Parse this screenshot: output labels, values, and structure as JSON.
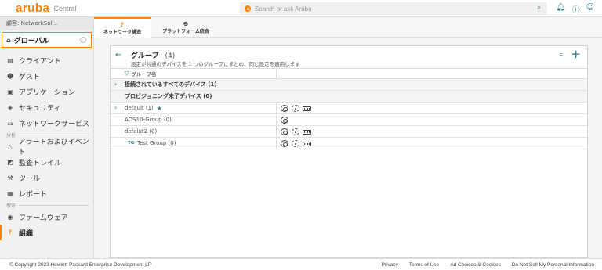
{
  "header": {
    "logo": "aruba",
    "product": "Central",
    "search_placeholder": "Search or ask Aruba"
  },
  "sidebar": {
    "customer": "顧客: NetworkSol...",
    "global_label": "グローバル",
    "items": [
      {
        "label": "クライアント"
      },
      {
        "label": "ゲスト"
      },
      {
        "label": "アプリケーション"
      },
      {
        "label": "セキュリティ"
      },
      {
        "label": "ネットワークサービス"
      }
    ],
    "section_analysis": "分析",
    "analysis_items": [
      {
        "label": "アラートおよびイベント"
      },
      {
        "label": "監査トレイル"
      },
      {
        "label": "ツール"
      },
      {
        "label": "レポート"
      }
    ],
    "section_maintenance": "保守",
    "maintenance_items": [
      {
        "label": "ファームウェア"
      },
      {
        "label": "組織"
      }
    ]
  },
  "tabs": [
    {
      "label": "ネットワーク構造"
    },
    {
      "label": "プラットフォーム統合"
    }
  ],
  "groups_panel": {
    "title": "グループ",
    "count": "(4)",
    "subtitle": "設定が共通のデバイスを 1 つのグループにまとめ、同じ設定を適用します",
    "column_header": "グループ名",
    "all_devices": "接続されているすべてのデバイス (1)",
    "unprovisioned": "プロビジョニング未了デバイス (0)",
    "rows": [
      {
        "name": "default (1)"
      },
      {
        "name": "AOS10-Group (0)"
      },
      {
        "name": "defalut2 (0)"
      },
      {
        "badge": "TG",
        "name": "Test Group (0)"
      }
    ]
  },
  "footer": {
    "copyright": "© Copyright 2023 Hewlett Packard Enterprise Development LP",
    "links": [
      "Privacy",
      "Terms of Use",
      "Ad Choices & Cookies",
      "Do Not Sell My Personal Information"
    ]
  }
}
